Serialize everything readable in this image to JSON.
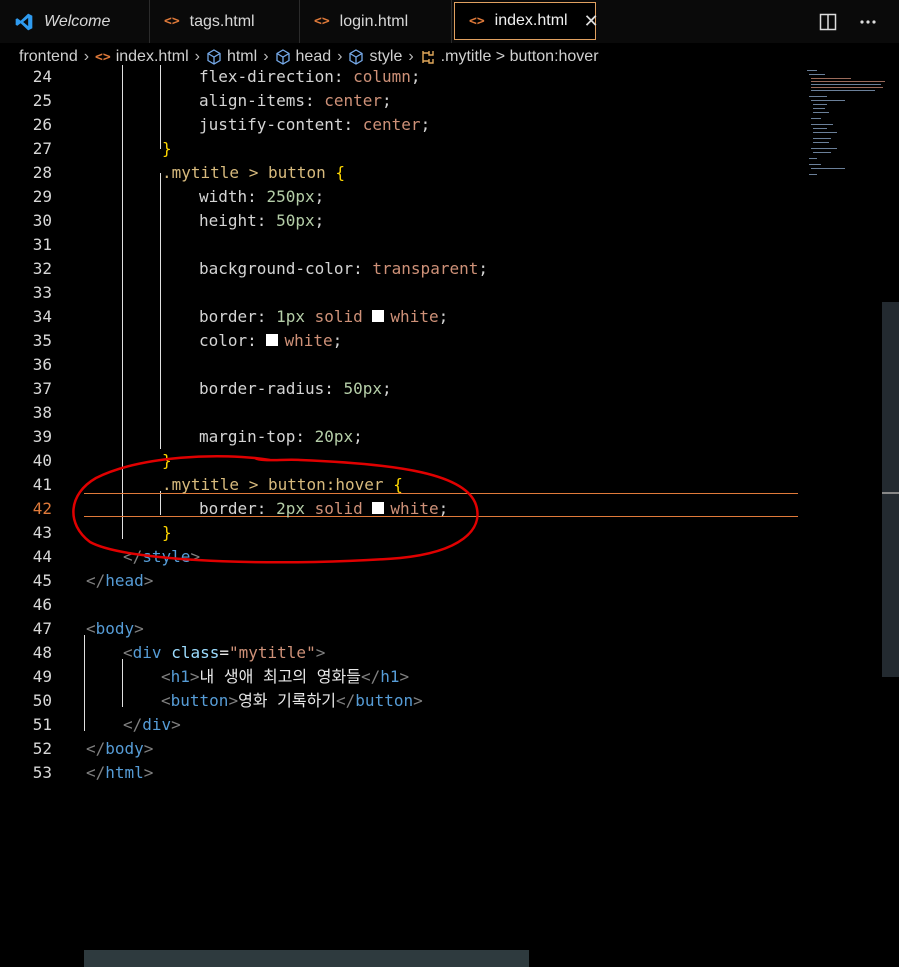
{
  "tabs": [
    {
      "label": "Welcome",
      "active": false
    },
    {
      "label": "tags.html",
      "active": false
    },
    {
      "label": "login.html",
      "active": false
    },
    {
      "label": "index.html",
      "active": true
    }
  ],
  "tab_icons": {
    "file": "<>",
    "close": "✕"
  },
  "breadcrumb": [
    "frontend",
    "index.html",
    "html",
    "head",
    "style",
    ".mytitle > button:hover"
  ],
  "colors": {
    "accent": "#e07a3a",
    "annotation": "#e00000",
    "background": "#000000"
  },
  "code": {
    "l24": {
      "n": "24",
      "prop": "flex-direction",
      "value": "column"
    },
    "l25": {
      "n": "25",
      "prop": "align-items",
      "value": "center"
    },
    "l26": {
      "n": "26",
      "prop": "justify-content",
      "value": "center"
    },
    "l27": {
      "n": "27",
      "brace": "}"
    },
    "l28": {
      "n": "28",
      "selector": ".mytitle > button",
      "brace": "{"
    },
    "l29": {
      "n": "29",
      "prop": "width",
      "value": "250px"
    },
    "l30": {
      "n": "30",
      "prop": "height",
      "value": "50px"
    },
    "l31": {
      "n": "31"
    },
    "l32": {
      "n": "32",
      "prop": "background-color",
      "value": "transparent"
    },
    "l33": {
      "n": "33"
    },
    "l34": {
      "n": "34",
      "prop": "border",
      "num": "1px",
      "style": "solid",
      "color": "white"
    },
    "l35": {
      "n": "35",
      "prop": "color",
      "color": "white"
    },
    "l36": {
      "n": "36"
    },
    "l37": {
      "n": "37",
      "prop": "border-radius",
      "value": "50px"
    },
    "l38": {
      "n": "38"
    },
    "l39": {
      "n": "39",
      "prop": "margin-top",
      "value": "20px"
    },
    "l40": {
      "n": "40",
      "brace": "}"
    },
    "l41": {
      "n": "41",
      "selector": ".mytitle > button:hover",
      "brace": "{"
    },
    "l42": {
      "n": "42",
      "prop": "border",
      "num": "2px",
      "style": "solid",
      "color": "white"
    },
    "l43": {
      "n": "43",
      "brace": "}"
    },
    "l44": {
      "n": "44",
      "open": "</",
      "tag": "style",
      "close": ">"
    },
    "l45": {
      "n": "45",
      "open": "</",
      "tag": "head",
      "close": ">"
    },
    "l46": {
      "n": "46"
    },
    "l47": {
      "n": "47",
      "open": "<",
      "tag": "body",
      "close": ">"
    },
    "l48": {
      "n": "48",
      "open": "<",
      "tag": "div",
      "attr": "class",
      "eq": "=",
      "str": "\"mytitle\"",
      "close": ">"
    },
    "l49": {
      "n": "49",
      "tag": "h1",
      "text": "내 생애 최고의 영화들"
    },
    "l50": {
      "n": "50",
      "tag": "button",
      "text": "영화 기록하기"
    },
    "l51": {
      "n": "51",
      "open": "</",
      "tag": "div",
      "close": ">"
    },
    "l52": {
      "n": "52",
      "open": "</",
      "tag": "body",
      "close": ">"
    },
    "l53": {
      "n": "53",
      "open": "</",
      "tag": "html",
      "close": ">"
    }
  }
}
